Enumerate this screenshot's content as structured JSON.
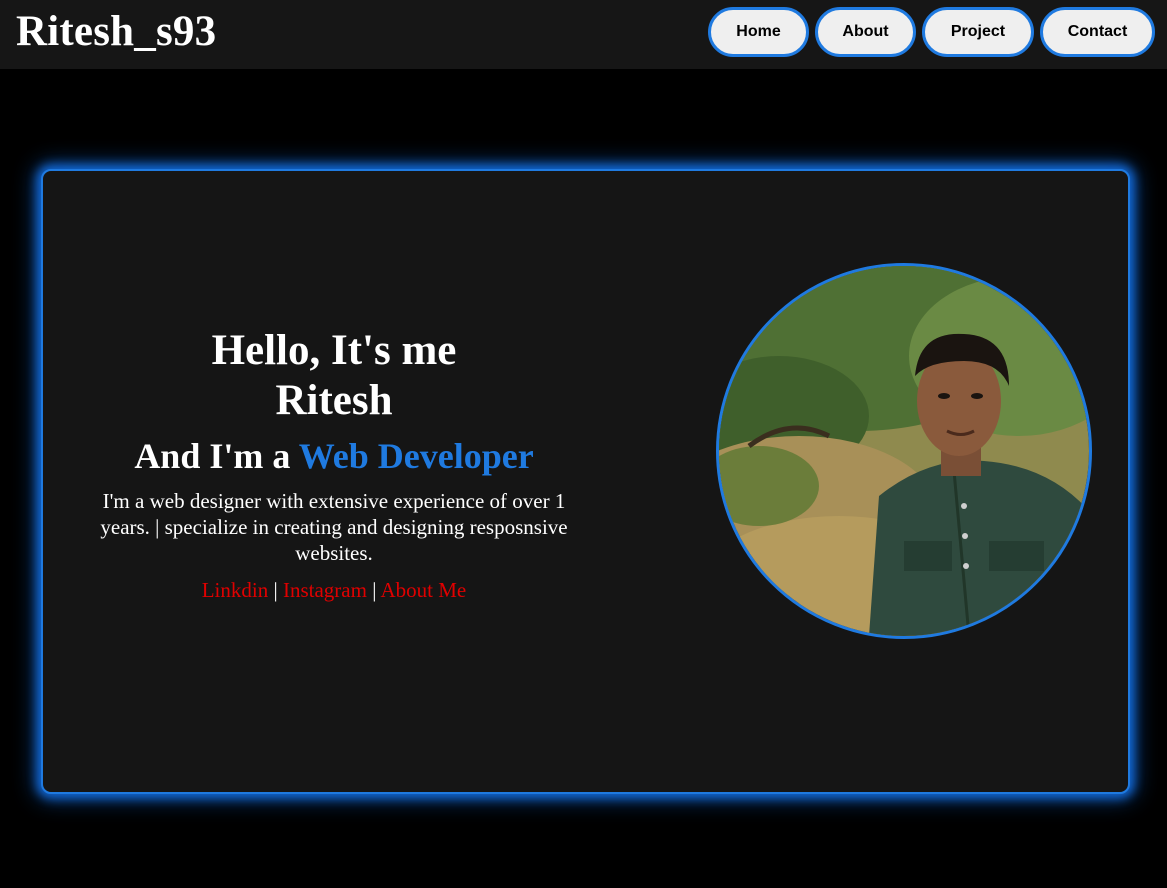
{
  "header": {
    "brand": "Ritesh_s93",
    "nav": [
      {
        "label": "Home"
      },
      {
        "label": "About"
      },
      {
        "label": "Project"
      },
      {
        "label": "Contact"
      }
    ]
  },
  "hero": {
    "greeting_line1": "Hello, It's me",
    "greeting_line2": "Ritesh",
    "role_prefix": "And I'm a",
    "role_highlight": "Web Developer",
    "bio": "I'm a web designer with extensive experience of over 1 years. | specialize in creating and designing resposnsive websites.",
    "links": [
      {
        "label": "Linkdin"
      },
      {
        "label": "Instagram"
      },
      {
        "label": "About Me"
      }
    ],
    "link_separator": "|"
  },
  "colors": {
    "background": "#000000",
    "surface": "#151515",
    "accent": "#1f7ae0",
    "link": "#e00000",
    "text": "#ffffff"
  }
}
